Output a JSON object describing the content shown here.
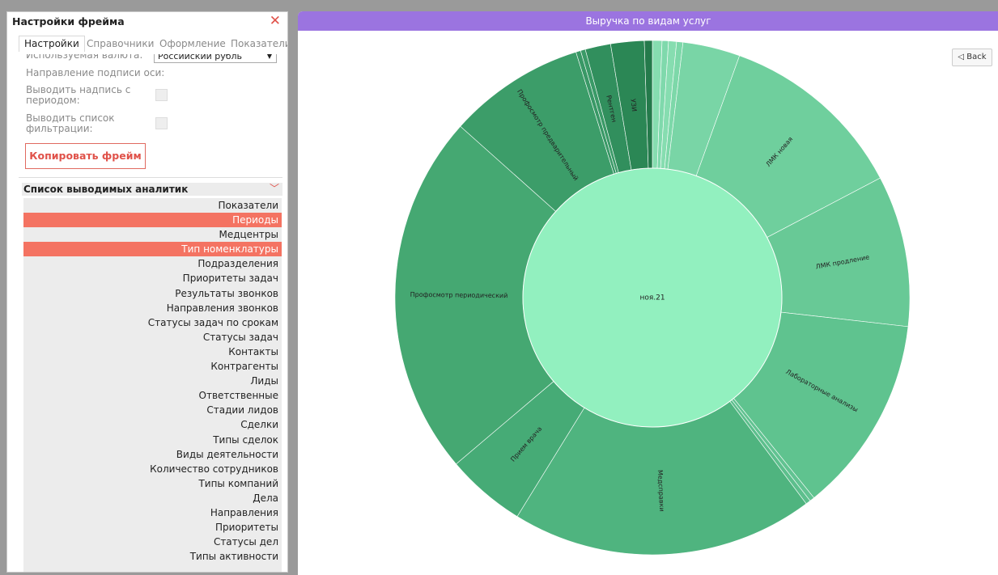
{
  "settings_panel": {
    "title": "Настройки фрейма",
    "close_glyph": "✕",
    "tabs": [
      "Настройки",
      "Справочники",
      "Оформление",
      "Показатели"
    ],
    "currency_label": "Используемая валюта:",
    "currency_value": "Российский рубль",
    "axis_direction_label": "Направление подписи оси:",
    "period_caption_label": "Выводить надпись с периодом:",
    "filter_list_label": "Выводить список фильтрации:",
    "copy_button": "Копировать фрейм"
  },
  "analytics_list": {
    "header": "Список выводимых аналитик",
    "items": [
      {
        "label": "Показатели",
        "selected": false
      },
      {
        "label": "Периоды",
        "selected": true
      },
      {
        "label": "Медцентры",
        "selected": false
      },
      {
        "label": "Тип номенклатуры",
        "selected": true
      },
      {
        "label": "Подразделения",
        "selected": false
      },
      {
        "label": "Приоритеты задач",
        "selected": false
      },
      {
        "label": "Результаты звонков",
        "selected": false
      },
      {
        "label": "Направления звонков",
        "selected": false
      },
      {
        "label": "Статусы задач по срокам",
        "selected": false
      },
      {
        "label": "Статусы задач",
        "selected": false
      },
      {
        "label": "Контакты",
        "selected": false
      },
      {
        "label": "Контрагенты",
        "selected": false
      },
      {
        "label": "Лиды",
        "selected": false
      },
      {
        "label": "Ответственные",
        "selected": false
      },
      {
        "label": "Стадии лидов",
        "selected": false
      },
      {
        "label": "Сделки",
        "selected": false
      },
      {
        "label": "Типы сделок",
        "selected": false
      },
      {
        "label": "Виды деятельности",
        "selected": false
      },
      {
        "label": "Количество сотрудников",
        "selected": false
      },
      {
        "label": "Типы компаний",
        "selected": false
      },
      {
        "label": "Дела",
        "selected": false
      },
      {
        "label": "Направления",
        "selected": false
      },
      {
        "label": "Приоритеты",
        "selected": false
      },
      {
        "label": "Статусы дел",
        "selected": false
      },
      {
        "label": "Типы активности",
        "selected": false
      }
    ]
  },
  "chart_panel": {
    "back_label": "◁ Back"
  },
  "chart_data": {
    "type": "sunburst",
    "title": "Выручка по видам услуг",
    "center_label": "ноя.21",
    "segments": [
      {
        "label": "",
        "share": 0.6,
        "color": "#86ddb0"
      },
      {
        "label": "",
        "share": 0.4,
        "color": "#7fd9ac"
      },
      {
        "label": "",
        "share": 0.5,
        "color": "#86ddb0"
      },
      {
        "label": "",
        "share": 0.4,
        "color": "#7dd8a9"
      },
      {
        "label": "",
        "share": 3.6,
        "color": "#79d5a6"
      },
      {
        "label": "ЛМК новая",
        "share": 11.8,
        "color": "#6fcf9d"
      },
      {
        "label": "ЛМК продление",
        "share": 9.5,
        "color": "#68c996"
      },
      {
        "label": "Лабораторные анализы",
        "share": 12.4,
        "color": "#5fc38f"
      },
      {
        "label": "",
        "share": 0.3,
        "color": "#62c392"
      },
      {
        "label": "",
        "share": 0.3,
        "color": "#5dbf8d"
      },
      {
        "label": "Медсправки",
        "share": 19.0,
        "color": "#4fb47f"
      },
      {
        "label": "Прием врача",
        "share": 5.0,
        "color": "#46ab76"
      },
      {
        "label": "Профосмотр периодический",
        "share": 22.8,
        "color": "#45a872"
      },
      {
        "label": "Профосмотр предварительный",
        "share": 8.6,
        "color": "#3c9d69"
      },
      {
        "label": "",
        "share": 0.3,
        "color": "#399866"
      },
      {
        "label": "",
        "share": 0.3,
        "color": "#3a9a67"
      },
      {
        "label": "Рентген",
        "share": 1.6,
        "color": "#318f5d"
      },
      {
        "label": "УЗИ",
        "share": 2.1,
        "color": "#2b8755"
      },
      {
        "label": "",
        "share": 0.5,
        "color": "#247a4b"
      }
    ],
    "colors": {
      "center": "#92f0bf",
      "title_bar": "#9b74e0"
    }
  }
}
